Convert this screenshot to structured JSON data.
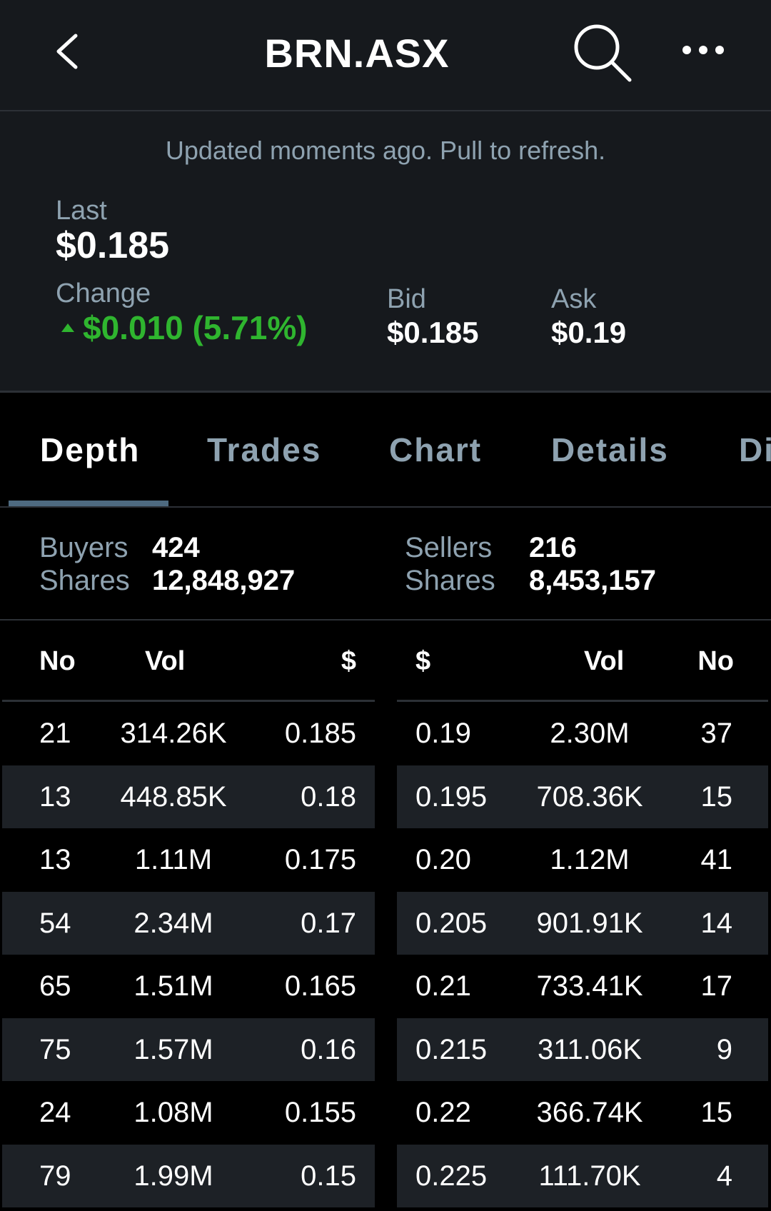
{
  "header": {
    "title": "BRN.ASX",
    "back_icon": "chevron-left-icon",
    "search_icon": "search-icon",
    "more_icon": "more-horizontal-icon"
  },
  "quote": {
    "updated_text": "Updated moments ago. Pull to refresh.",
    "last_label": "Last",
    "last_value": "$0.185",
    "change_label": "Change",
    "change_value": "$0.010 (5.71%)",
    "change_direction": "up",
    "change_color": "#2fb52f",
    "bid_label": "Bid",
    "bid_value": "$0.185",
    "ask_label": "Ask",
    "ask_value": "$0.19"
  },
  "tabs": [
    {
      "label": "Depth",
      "active": true
    },
    {
      "label": "Trades",
      "active": false
    },
    {
      "label": "Chart",
      "active": false
    },
    {
      "label": "Details",
      "active": false
    },
    {
      "label": "Di",
      "active": false
    }
  ],
  "summary": {
    "buyers_label": "Buyers",
    "buyers_value": "424",
    "buy_shares_label": "Shares",
    "buy_shares_value": "12,848,927",
    "sellers_label": "Sellers",
    "sellers_value": "216",
    "sell_shares_label": "Shares",
    "sell_shares_value": "8,453,157"
  },
  "buy_table": {
    "headers": [
      "No",
      "Vol",
      "$"
    ],
    "rows": [
      [
        "21",
        "314.26K",
        "0.185"
      ],
      [
        "13",
        "448.85K",
        "0.18"
      ],
      [
        "13",
        "1.11M",
        "0.175"
      ],
      [
        "54",
        "2.34M",
        "0.17"
      ],
      [
        "65",
        "1.51M",
        "0.165"
      ],
      [
        "75",
        "1.57M",
        "0.16"
      ],
      [
        "24",
        "1.08M",
        "0.155"
      ],
      [
        "79",
        "1.99M",
        "0.15"
      ]
    ]
  },
  "sell_table": {
    "headers": [
      "$",
      "Vol",
      "No"
    ],
    "rows": [
      [
        "0.19",
        "2.30M",
        "37"
      ],
      [
        "0.195",
        "708.36K",
        "15"
      ],
      [
        "0.20",
        "1.12M",
        "41"
      ],
      [
        "0.205",
        "901.91K",
        "14"
      ],
      [
        "0.21",
        "733.41K",
        "17"
      ],
      [
        "0.215",
        "311.06K",
        "9"
      ],
      [
        "0.22",
        "366.74K",
        "15"
      ],
      [
        "0.225",
        "111.70K",
        "4"
      ]
    ]
  },
  "colors": {
    "background": "#000000",
    "panel": "#16191d",
    "muted_text": "#8ea2b0",
    "row_alt": "#1d2126",
    "positive": "#2fb52f",
    "tab_indicator": "#4e6a80"
  }
}
